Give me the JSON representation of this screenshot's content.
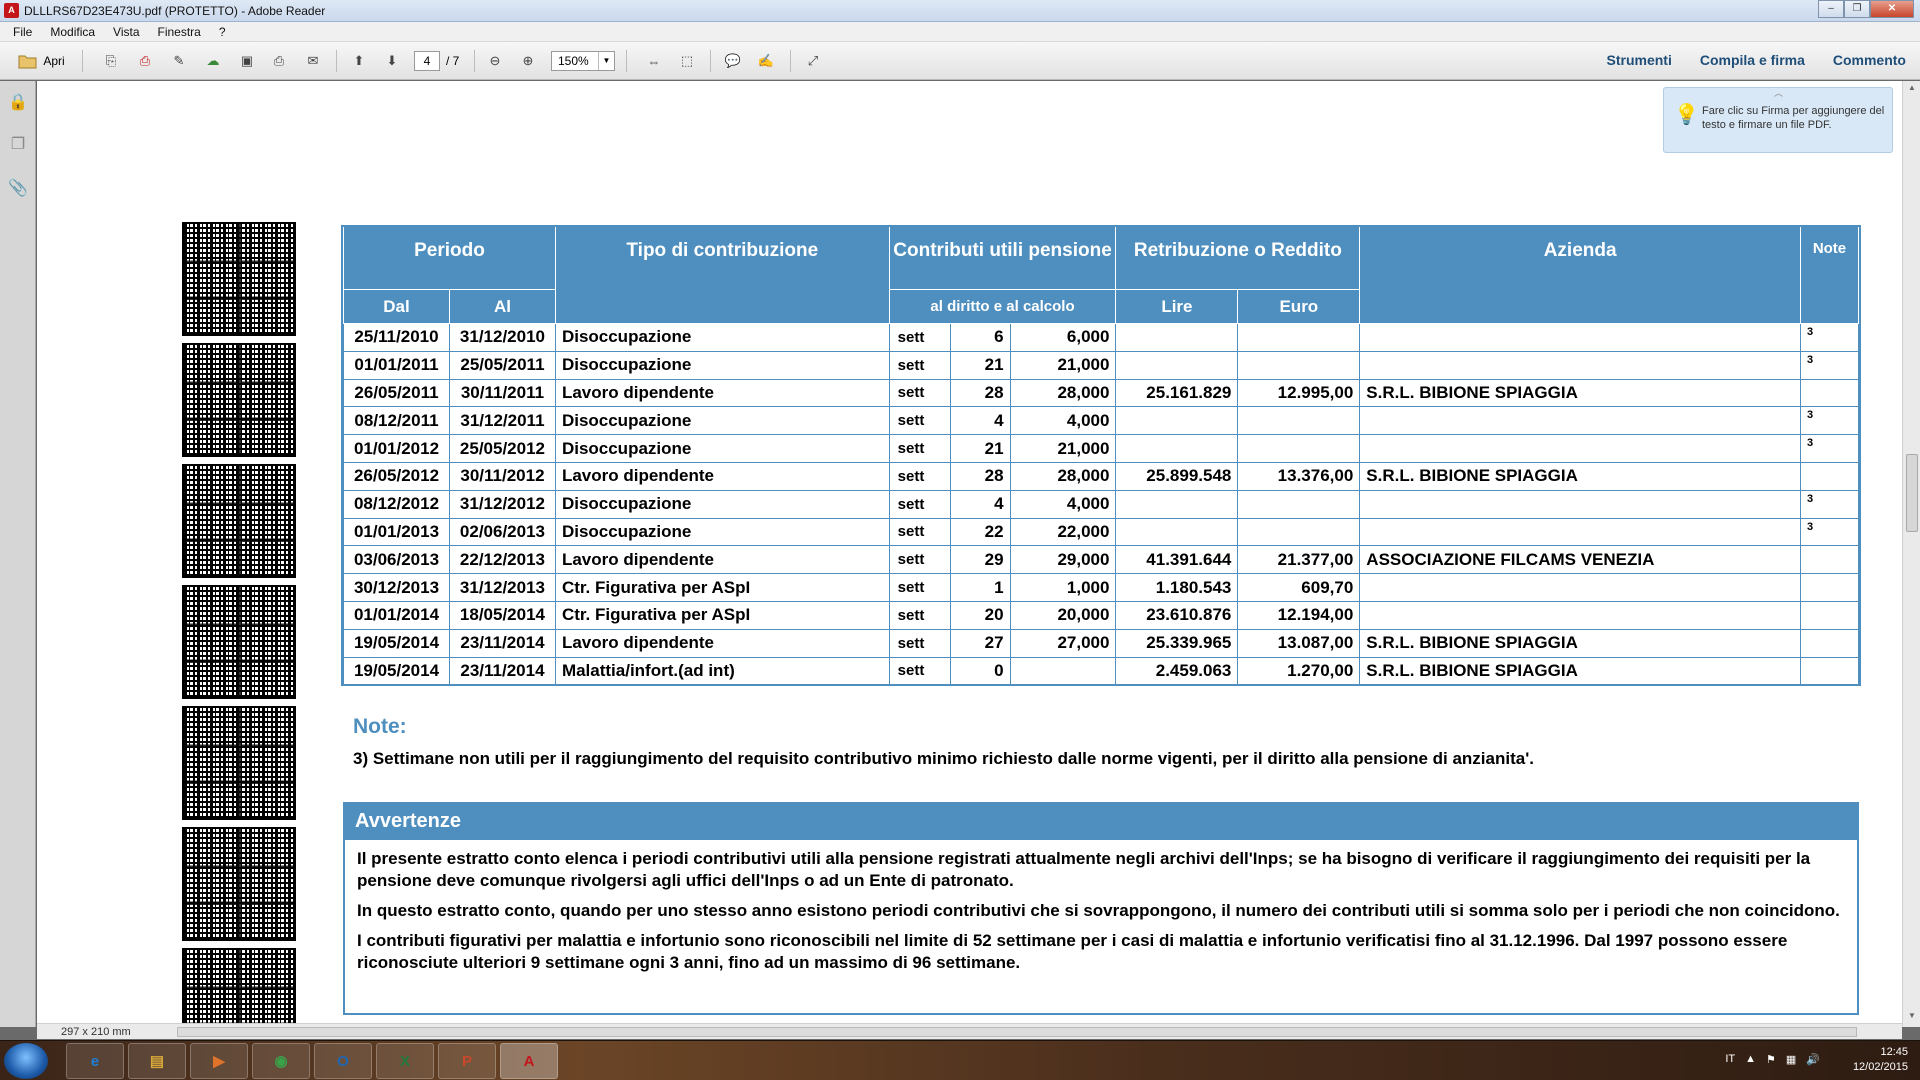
{
  "window": {
    "title": "DLLLRS67D23E473U.pdf (PROTETTO) - Adobe Reader",
    "app_icon": "adobe-reader-icon"
  },
  "menu": [
    "File",
    "Modifica",
    "Vista",
    "Finestra",
    "?"
  ],
  "toolbar": {
    "open_label": "Apri",
    "page_current": "4",
    "page_total": "/ 7",
    "zoom": "150%",
    "right_links": [
      "Strumenti",
      "Compila e firma",
      "Commento"
    ]
  },
  "tooltip": {
    "text": "Fare clic su Firma per aggiungere del testo e firmare un file PDF."
  },
  "status": {
    "page_size": "297 x 210 mm"
  },
  "table": {
    "headers": {
      "periodo": "Periodo",
      "tipo": "Tipo di contribuzione",
      "contributi": "Contributi utili pensione",
      "retribuzione": "Retribuzione o Reddito",
      "azienda": "Azienda",
      "note": "Note",
      "dal": "Dal",
      "al": "Al",
      "diritto_calcolo": "al diritto e al calcolo",
      "lire": "Lire",
      "euro": "Euro"
    },
    "rows": [
      {
        "dal": "25/11/2010",
        "al": "31/12/2010",
        "tipo": "Disoccupazione",
        "unit": "sett",
        "diritto": "6",
        "calcolo": "6,000",
        "lire": "",
        "euro": "",
        "azienda": "",
        "note": "3"
      },
      {
        "dal": "01/01/2011",
        "al": "25/05/2011",
        "tipo": "Disoccupazione",
        "unit": "sett",
        "diritto": "21",
        "calcolo": "21,000",
        "lire": "",
        "euro": "",
        "azienda": "",
        "note": "3"
      },
      {
        "dal": "26/05/2011",
        "al": "30/11/2011",
        "tipo": "Lavoro dipendente",
        "unit": "sett",
        "diritto": "28",
        "calcolo": "28,000",
        "lire": "25.161.829",
        "euro": "12.995,00",
        "azienda": "S.R.L. BIBIONE SPIAGGIA",
        "note": ""
      },
      {
        "dal": "08/12/2011",
        "al": "31/12/2011",
        "tipo": "Disoccupazione",
        "unit": "sett",
        "diritto": "4",
        "calcolo": "4,000",
        "lire": "",
        "euro": "",
        "azienda": "",
        "note": "3"
      },
      {
        "dal": "01/01/2012",
        "al": "25/05/2012",
        "tipo": "Disoccupazione",
        "unit": "sett",
        "diritto": "21",
        "calcolo": "21,000",
        "lire": "",
        "euro": "",
        "azienda": "",
        "note": "3"
      },
      {
        "dal": "26/05/2012",
        "al": "30/11/2012",
        "tipo": "Lavoro dipendente",
        "unit": "sett",
        "diritto": "28",
        "calcolo": "28,000",
        "lire": "25.899.548",
        "euro": "13.376,00",
        "azienda": "S.R.L. BIBIONE SPIAGGIA",
        "note": ""
      },
      {
        "dal": "08/12/2012",
        "al": "31/12/2012",
        "tipo": "Disoccupazione",
        "unit": "sett",
        "diritto": "4",
        "calcolo": "4,000",
        "lire": "",
        "euro": "",
        "azienda": "",
        "note": "3"
      },
      {
        "dal": "01/01/2013",
        "al": "02/06/2013",
        "tipo": "Disoccupazione",
        "unit": "sett",
        "diritto": "22",
        "calcolo": "22,000",
        "lire": "",
        "euro": "",
        "azienda": "",
        "note": "3"
      },
      {
        "dal": "03/06/2013",
        "al": "22/12/2013",
        "tipo": "Lavoro dipendente",
        "unit": "sett",
        "diritto": "29",
        "calcolo": "29,000",
        "lire": "41.391.644",
        "euro": "21.377,00",
        "azienda": "ASSOCIAZIONE FILCAMS VENEZIA",
        "note": ""
      },
      {
        "dal": "30/12/2013",
        "al": "31/12/2013",
        "tipo": "Ctr. Figurativa per ASpI",
        "unit": "sett",
        "diritto": "1",
        "calcolo": "1,000",
        "lire": "1.180.543",
        "euro": "609,70",
        "azienda": "",
        "note": ""
      },
      {
        "dal": "01/01/2014",
        "al": "18/05/2014",
        "tipo": "Ctr. Figurativa per ASpI",
        "unit": "sett",
        "diritto": "20",
        "calcolo": "20,000",
        "lire": "23.610.876",
        "euro": "12.194,00",
        "azienda": "",
        "note": ""
      },
      {
        "dal": "19/05/2014",
        "al": "23/11/2014",
        "tipo": "Lavoro dipendente",
        "unit": "sett",
        "diritto": "27",
        "calcolo": "27,000",
        "lire": "25.339.965",
        "euro": "13.087,00",
        "azienda": "S.R.L. BIBIONE SPIAGGIA",
        "note": ""
      },
      {
        "dal": "19/05/2014",
        "al": "23/11/2014",
        "tipo": "Malattia/infort.(ad int)",
        "unit": "sett",
        "diritto": "0",
        "calcolo": "",
        "lire": "2.459.063",
        "euro": "1.270,00",
        "azienda": "S.R.L. BIBIONE SPIAGGIA",
        "note": ""
      }
    ]
  },
  "notes": {
    "title": "Note:",
    "text": "3) Settimane non utili per il raggiungimento del requisito contributivo minimo richiesto dalle norme vigenti, per il diritto alla pensione di anzianita'."
  },
  "avvertenze": {
    "title": "Avvertenze",
    "paragraphs": [
      "Il presente estratto conto elenca i periodi contributivi utili alla pensione registrati attualmente negli archivi dell'Inps; se ha bisogno di verificare il raggiungimento dei requisiti per la pensione deve comunque rivolgersi agli uffici dell'Inps o ad un Ente di patronato.",
      "In questo estratto conto, quando per uno stesso anno esistono periodi contributivi che si sovrappongono, il numero dei contributi utili si somma solo per i periodi che non coincidono.",
      "I contributi figurativi per malattia e infortunio sono riconoscibili nel limite di 52 settimane per i casi di malattia e infortunio verificatisi fino al 31.12.1996. Dal 1997 possono essere riconosciute ulteriori 9 settimane ogni 3 anni, fino ad un massimo di 96 settimane."
    ]
  },
  "taskbar": {
    "apps": [
      "internet-explorer-icon",
      "file-explorer-icon",
      "media-player-icon",
      "chrome-icon",
      "outlook-icon",
      "excel-icon",
      "powerpoint-icon",
      "adobe-reader-icon"
    ],
    "app_labels": [
      "e",
      "▤",
      "▶",
      "◉",
      "O",
      "X",
      "P",
      "A"
    ],
    "lang": "IT",
    "time": "12:45",
    "date": "12/02/2015"
  }
}
